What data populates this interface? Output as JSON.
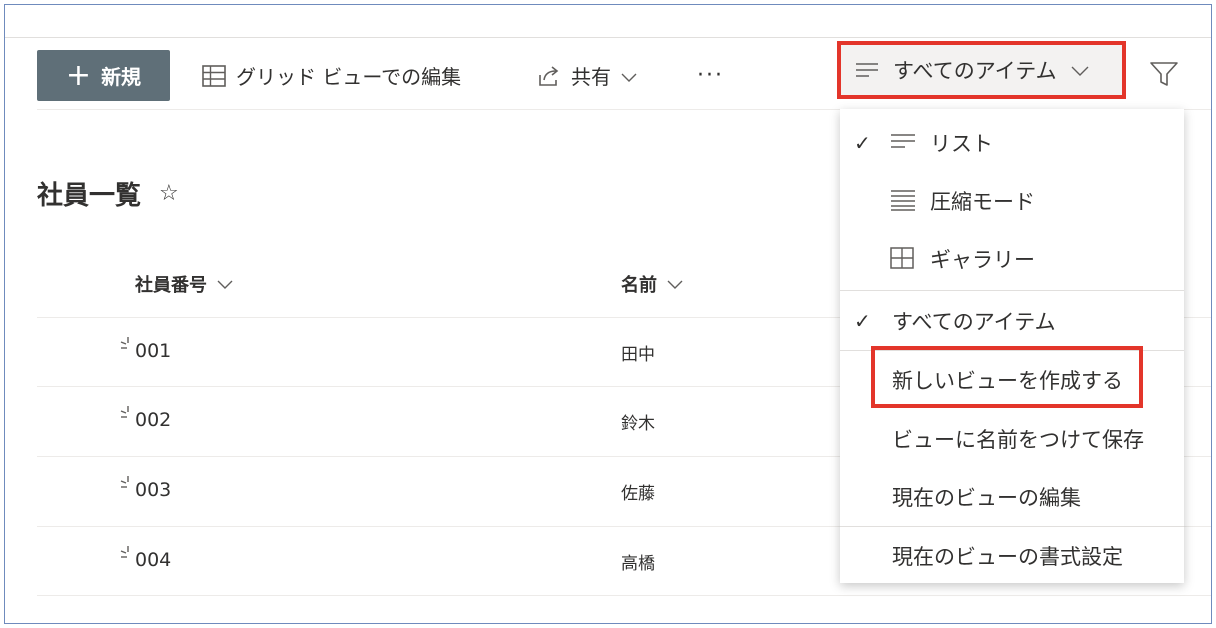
{
  "toolbar": {
    "new_label": "新規",
    "grid_edit_label": "グリッド ビューでの編集",
    "share_label": "共有",
    "more_label": "···",
    "view_selector_label": "すべてのアイテム"
  },
  "list": {
    "title": "社員一覧",
    "columns": {
      "id": "社員番号",
      "name": "名前"
    },
    "rows": [
      {
        "id": "001",
        "name": "田中"
      },
      {
        "id": "002",
        "name": "鈴木"
      },
      {
        "id": "003",
        "name": "佐藤"
      },
      {
        "id": "004",
        "name": "高橋"
      }
    ]
  },
  "view_menu": {
    "layouts": [
      {
        "label": "リスト",
        "icon": "list-lines-icon",
        "checked": true
      },
      {
        "label": "圧縮モード",
        "icon": "compact-list-icon",
        "checked": false
      },
      {
        "label": "ギャラリー",
        "icon": "gallery-grid-icon",
        "checked": false
      }
    ],
    "views": [
      {
        "label": "すべてのアイテム",
        "checked": true
      },
      {
        "label": "新しいビューを作成する",
        "checked": false
      },
      {
        "label": "ビューに名前をつけて保存",
        "checked": false
      },
      {
        "label": "現在のビューの編集",
        "checked": false
      }
    ],
    "format": {
      "label": "現在のビューの書式設定"
    }
  },
  "colors": {
    "new_button": "#5f6f78",
    "highlight": "#e3352a",
    "text": "#323130"
  }
}
